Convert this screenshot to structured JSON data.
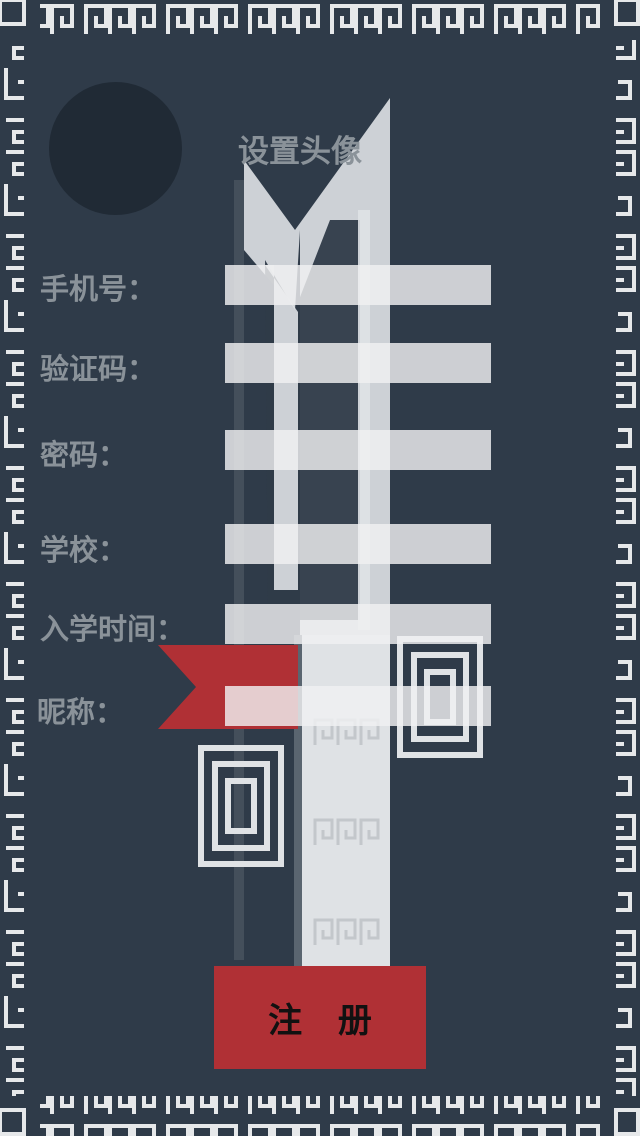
{
  "avatar": {
    "label": "设置头像"
  },
  "fields": [
    {
      "key": "phone",
      "label": "手机号：",
      "value": ""
    },
    {
      "key": "code",
      "label": "验证码：",
      "value": ""
    },
    {
      "key": "password",
      "label": "密码：",
      "value": ""
    },
    {
      "key": "school",
      "label": "学校：",
      "value": ""
    },
    {
      "key": "enroll_time",
      "label": "入学时间：",
      "value": ""
    },
    {
      "key": "nickname",
      "label": "昵称：",
      "value": ""
    }
  ],
  "submit": {
    "label": "注 册"
  },
  "colors": {
    "background": "#2f3b49",
    "pattern": "#e6e8ea",
    "accent_red": "#b03035",
    "label_gray": "#8a9299",
    "avatar_dark": "#202a35"
  },
  "icons": [
    "greek-key-border-pattern",
    "brush-sword-decoration",
    "red-ribbon",
    "square-spiral-ornament"
  ]
}
